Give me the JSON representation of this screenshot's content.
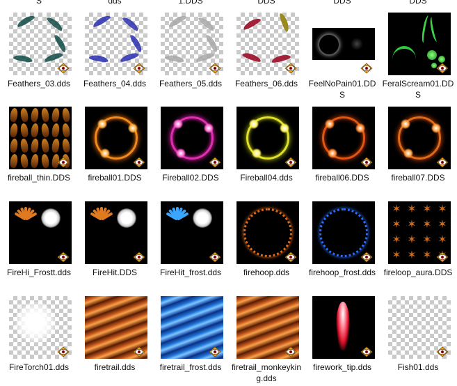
{
  "top_labels": [
    "S",
    "dds",
    "1.DDS",
    "DDS",
    "DDS",
    "DDS"
  ],
  "files": [
    {
      "name": "Feathers_03.dds",
      "thumb": "feathers",
      "color": "#0f4b44"
    },
    {
      "name": "Feathers_04.dds",
      "thumb": "feathers",
      "color": "#2a2fb0"
    },
    {
      "name": "Feathers_05.dds",
      "thumb": "feathers",
      "color": "#a8a8a8"
    },
    {
      "name": "Feathers_06.dds",
      "thumb": "feathers2",
      "color": "#a3223a",
      "color2": "#9a8a20"
    },
    {
      "name": "FeelNoPain01.DDS",
      "thumb": "feelnopain"
    },
    {
      "name": "FeralScream01.DDS",
      "thumb": "feral"
    },
    {
      "name": "fireball_thin.DDS",
      "thumb": "flames_dark"
    },
    {
      "name": "fireball01.DDS",
      "thumb": "ring_orange"
    },
    {
      "name": "Fireball02.DDS",
      "thumb": "ring_pink"
    },
    {
      "name": "Fireball04.dds",
      "thumb": "ring_yellow"
    },
    {
      "name": "fireball06.DDS",
      "thumb": "ring_orange2"
    },
    {
      "name": "fireball07.DDS",
      "thumb": "ring_orange3"
    },
    {
      "name": "FireHi_Frostt.dds",
      "thumb": "firehit_orange"
    },
    {
      "name": "FireHit.DDS",
      "thumb": "firehit_orange"
    },
    {
      "name": "FireHit_frost.dds",
      "thumb": "firehit_blue"
    },
    {
      "name": "firehoop.dds",
      "thumb": "hoop_orange"
    },
    {
      "name": "firehoop_frost.dds",
      "thumb": "hoop_blue"
    },
    {
      "name": "fireloop_aura.DDS",
      "thumb": "aura"
    },
    {
      "name": "FireTorch01.dds",
      "thumb": "torch"
    },
    {
      "name": "firetrail.dds",
      "thumb": "trail_orange"
    },
    {
      "name": "firetrail_frost.dds",
      "thumb": "trail_blue"
    },
    {
      "name": "firetrail_monkeyking.dds",
      "thumb": "trail_orange"
    },
    {
      "name": "firework_tip.dds",
      "thumb": "firework"
    },
    {
      "name": "Fish01.dds",
      "thumb": "fish"
    }
  ],
  "icons": {
    "badge": "xnview-badge-icon"
  }
}
